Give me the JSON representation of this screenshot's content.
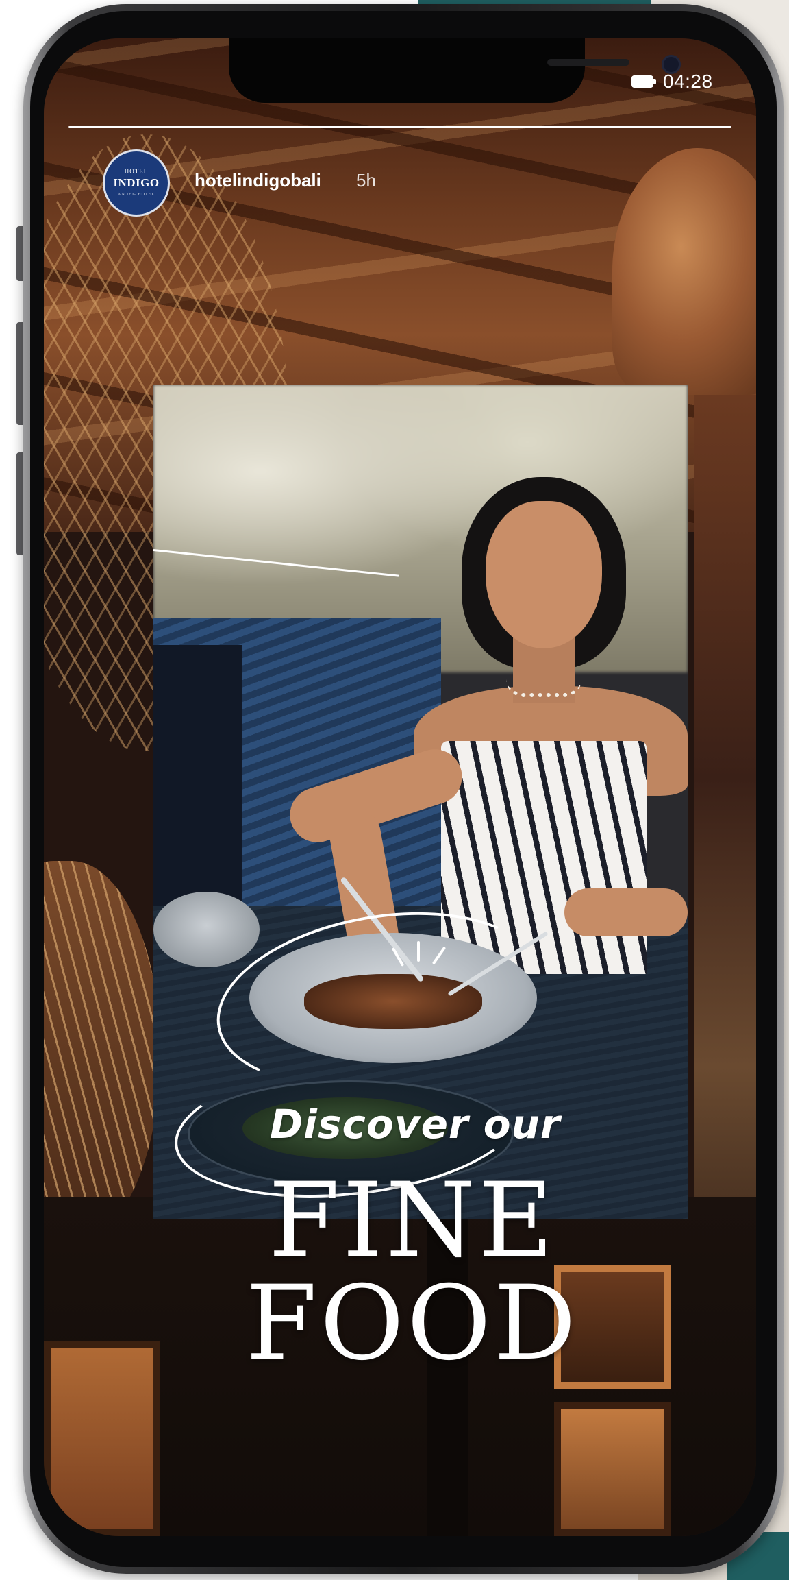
{
  "status_bar": {
    "time": "04:28"
  },
  "story": {
    "progress_fraction": 1.0,
    "account": {
      "username": "hotelindigobali",
      "time_ago": "5h",
      "avatar_logo": {
        "line1": "HOTEL",
        "line2": "INDIGO",
        "line3": "AN IHG HOTEL"
      }
    },
    "overlay": {
      "tagline": "Discover our",
      "headline": "FINE FOOD"
    }
  },
  "colors": {
    "avatar_bg": "#1b3a7a",
    "overlay_text": "#ffffff",
    "phone_frame": "#1a1a1b"
  }
}
